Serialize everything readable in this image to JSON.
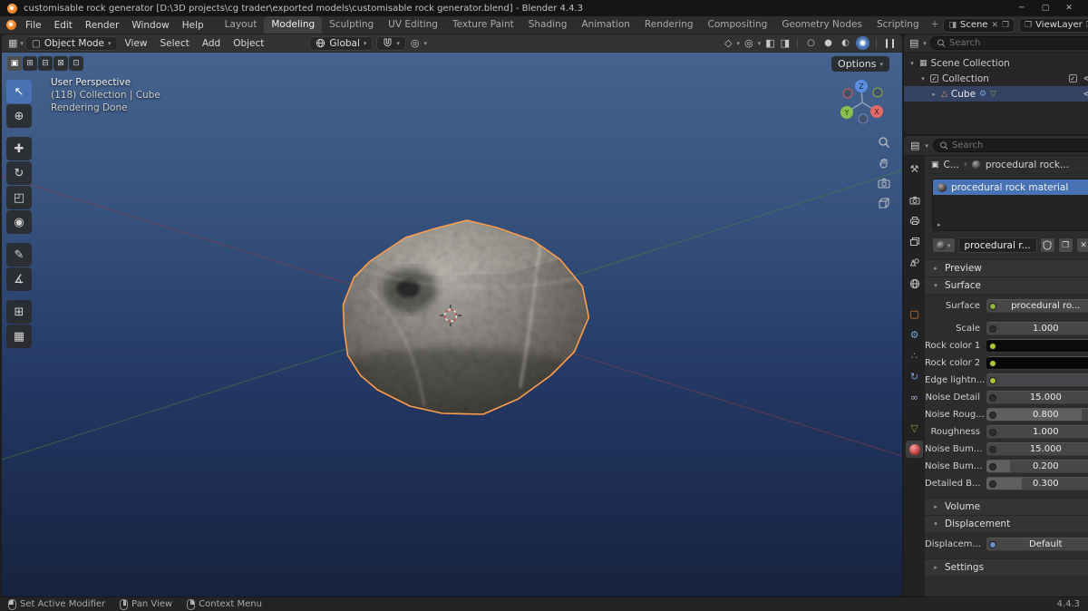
{
  "titlebar": {
    "title": "customisable rock generator [D:\\3D projects\\cg trader\\exported models\\customisable rock generator.blend] - Blender 4.4.3"
  },
  "menubar": {
    "menus": [
      "File",
      "Edit",
      "Render",
      "Window",
      "Help"
    ],
    "workspaces": [
      "Layout",
      "Modeling",
      "Sculpting",
      "UV Editing",
      "Texture Paint",
      "Shading",
      "Animation",
      "Rendering",
      "Compositing",
      "Geometry Nodes",
      "Scripting"
    ],
    "active_workspace": "Modeling",
    "add_tab": "+",
    "scene_label": "Scene",
    "viewlayer_label": "ViewLayer"
  },
  "tool_header": {
    "mode": "Object Mode",
    "menus": [
      "View",
      "Select",
      "Add",
      "Object"
    ],
    "orientation": "Global",
    "options_label": "Options"
  },
  "viewport": {
    "overlay": {
      "line1": "User Perspective",
      "line2": "(118) Collection | Cube",
      "line3": "Rendering Done"
    },
    "axis_labels": {
      "x": "X",
      "y": "Y",
      "z": "Z"
    }
  },
  "outliner": {
    "search_placeholder": "Search",
    "rows": [
      {
        "label": "Scene Collection"
      },
      {
        "label": "Collection"
      },
      {
        "label": "Cube"
      }
    ]
  },
  "properties": {
    "search_placeholder": "Search",
    "breadcrumb": {
      "object": "C...",
      "material": "procedural rock..."
    },
    "slots": [
      {
        "name": "procedural rock material"
      }
    ],
    "datablock": {
      "name": "procedural r..."
    },
    "panels": {
      "preview": "Preview",
      "surface": "Surface",
      "volume": "Volume",
      "displacement": "Displacement",
      "settings": "Settings"
    },
    "surface_rows": [
      {
        "label": "Surface",
        "value": "procedural ro..."
      },
      {
        "label": "Scale",
        "value": "1.000"
      },
      {
        "label": "Rock color 1",
        "swatch": "#0b0b0d"
      },
      {
        "label": "Rock color 2",
        "swatch": "#070708"
      },
      {
        "label": "Edge lightn...",
        "swatch": "#45454a"
      },
      {
        "label": "Noise Detail",
        "value": "15.000"
      },
      {
        "label": "Noise Roug...",
        "value": "0.800",
        "fill": 0.8
      },
      {
        "label": "Roughness",
        "value": "1.000"
      },
      {
        "label": "Noise Bum...",
        "value": "15.000"
      },
      {
        "label": "Noise Bum...",
        "value": "0.200",
        "fill": 0.2
      },
      {
        "label": "Detailed B...",
        "value": "0.300",
        "fill": 0.3
      }
    ],
    "displacement_row": {
      "label": "Displacem...",
      "value": "Default"
    }
  },
  "statusbar": {
    "hints": [
      "Set Active Modifier",
      "Pan View",
      "Context Menu"
    ],
    "version": "4.4.3"
  },
  "colors": {
    "accent": "#4772b3",
    "selection_outline": "#ff9e4a",
    "viewport_top": "#45638e",
    "viewport_bottom": "#16233f"
  },
  "icons": {
    "caret_down": "▾",
    "caret_right": "▸",
    "chevron": "›",
    "minimize": "─",
    "maximize": "▢",
    "close": "✕",
    "plus": "+",
    "minus": "−",
    "check": "✓",
    "tool_select": "↖",
    "tool_cursor": "⊕",
    "tool_move": "✚",
    "tool_rotate": "↻",
    "tool_scale": "◰",
    "tool_transform": "◉",
    "tool_annotate": "✎",
    "tool_measure": "∡",
    "tool_add_cube": "⊞",
    "tool_extra": "▦",
    "select_modes": [
      "▣",
      "⊞",
      "⊟",
      "⊠",
      "⊡"
    ],
    "editor_grid": "▦",
    "editor_list": "▤",
    "mode_icon": "▢",
    "proportional": "◎",
    "gizmo_toggle": "◇",
    "overlays_toggle": "◎",
    "xray_toggle": "◧",
    "compositor_toggle": "◨",
    "shade_wireframe": "○",
    "shade_solid": "●",
    "shade_material": "◐",
    "shade_rendered": "◉",
    "tab_tool": "⚒",
    "tab_object": "▢",
    "tab_modifiers": "⚙",
    "tab_particles": "∴",
    "tab_physics": "↻",
    "tab_constraints": "∞",
    "tab_data": "▽",
    "scene_collection": "▦",
    "collection": "▣",
    "mesh_triangle": "△",
    "modifier_badge": "⚙",
    "nodes_badge": "▽",
    "new_copy": "❐",
    "object_icon": "▣"
  }
}
